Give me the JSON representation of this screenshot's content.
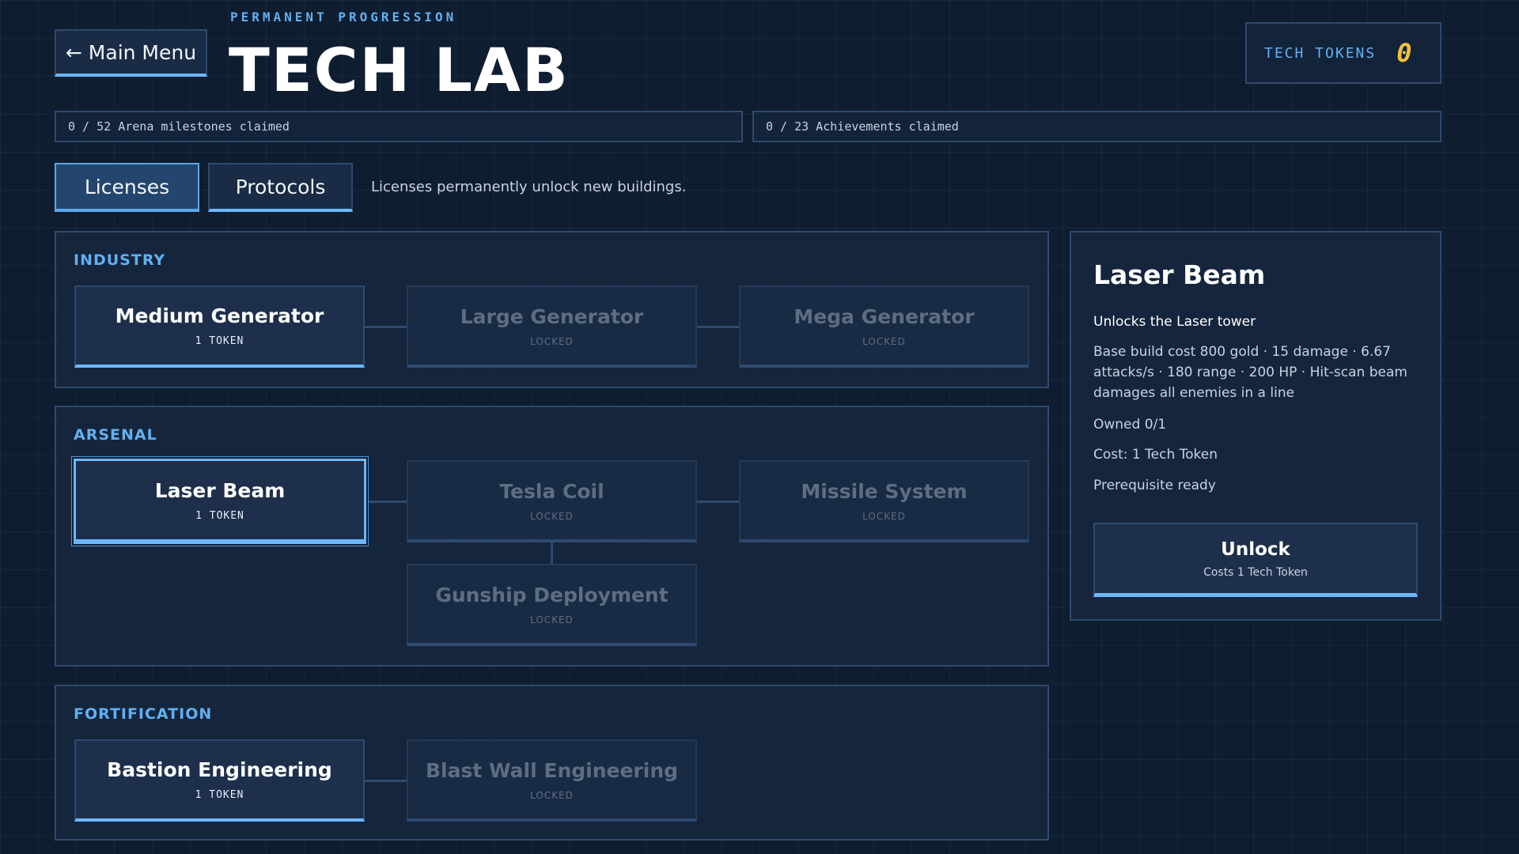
{
  "header": {
    "back_label": "← Main Menu",
    "subtitle": "PERMANENT PROGRESSION",
    "title": "TECH LAB",
    "tokens_label": "TECH TOKENS",
    "tokens_value": "0"
  },
  "progress": {
    "arena": "0 / 52 Arena milestones claimed",
    "achievements": "0 / 23 Achievements claimed"
  },
  "tabs": [
    {
      "label": "Licenses",
      "active": true
    },
    {
      "label": "Protocols",
      "active": false
    }
  ],
  "tab_description": "Licenses permanently unlock new buildings.",
  "sections": {
    "industry": {
      "title": "INDUSTRY",
      "nodes": [
        {
          "name": "Medium Generator",
          "sub": "1 TOKEN"
        },
        {
          "name": "Large Generator",
          "sub": "LOCKED"
        },
        {
          "name": "Mega Generator",
          "sub": "LOCKED"
        }
      ]
    },
    "arsenal": {
      "title": "ARSENAL",
      "nodes": [
        {
          "name": "Laser Beam",
          "sub": "1 TOKEN"
        },
        {
          "name": "Tesla Coil",
          "sub": "LOCKED"
        },
        {
          "name": "Missile System",
          "sub": "LOCKED"
        },
        {
          "name": "Gunship Deployment",
          "sub": "LOCKED"
        }
      ]
    },
    "fortification": {
      "title": "FORTIFICATION",
      "nodes": [
        {
          "name": "Bastion Engineering",
          "sub": "1 TOKEN"
        },
        {
          "name": "Blast Wall Engineering",
          "sub": "LOCKED"
        }
      ]
    }
  },
  "detail": {
    "title": "Laser Beam",
    "unlocks": "Unlocks the Laser tower",
    "description": "Base build cost 800 gold · 15 damage · 6.67 attacks/s · 180 range · 200 HP · Hit-scan beam damages all enemies in a line",
    "owned": "Owned 0/1",
    "cost": "Cost: 1 Tech Token",
    "prereq": "Prerequisite ready",
    "button_label": "Unlock",
    "button_sub": "Costs 1 Tech Token"
  },
  "colors": {
    "accent": "#6cb8ff",
    "token": "#f2c23a",
    "background": "#0f1d30"
  }
}
